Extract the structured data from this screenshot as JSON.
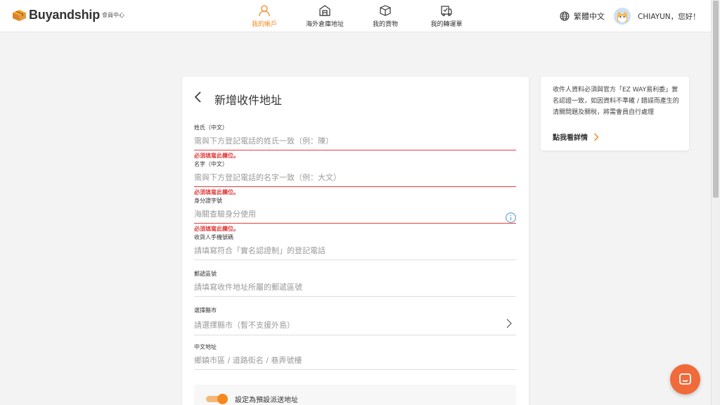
{
  "header": {
    "brand": "Buyandship",
    "member_center": "會員中心",
    "nav": [
      {
        "label": "我的帳戶",
        "icon": "user-icon",
        "active": true
      },
      {
        "label": "海外倉庫地址",
        "icon": "warehouse-icon",
        "active": false
      },
      {
        "label": "我的貨物",
        "icon": "box-icon",
        "active": false
      },
      {
        "label": "我的轉運單",
        "icon": "shipment-icon",
        "active": false
      }
    ],
    "language": "繁體中文",
    "greeting": "CHIAYUN，您好！"
  },
  "form": {
    "title": "新增收件地址",
    "fields": {
      "surname": {
        "label": "姓氏（中文）",
        "placeholder": "需與下方登記電話的姓氏一致（例：陳）",
        "error": "必須填寫此欄位。"
      },
      "given_name": {
        "label": "名字（中文）",
        "placeholder": "需與下方登記電話的名字一致（例：大文）",
        "error": "必須填寫此欄位。"
      },
      "id_number": {
        "label": "身分證字號",
        "placeholder": "海關查驗身分使用",
        "error": "必須填寫此欄位。"
      },
      "phone": {
        "label": "收貨人手機號碼",
        "placeholder": "請填寫符合「實名認證制」的登記電話"
      },
      "postal": {
        "label": "郵遞區號",
        "placeholder": "請填寫收件地址所屬的郵遞區號"
      },
      "city": {
        "label": "選擇縣市",
        "placeholder": "請選擇縣市（暫不支援外島）"
      },
      "address": {
        "label": "中文地址",
        "placeholder": "鄉鎮市區 / 道路街名 / 巷弄號樓"
      }
    },
    "default_toggle": {
      "label": "設定為預設派送地址",
      "on": true
    }
  },
  "side": {
    "notice": "收件人資料必須與官方「EZ WAY易利委」實名認證一致，如因資料不準確 / 錯誤而產生的清關問題及關稅，將需會員自行處理",
    "link": "點我看詳情"
  },
  "colors": {
    "accent": "#f5891f",
    "error": "#e14040",
    "chat": "#f06a3a"
  }
}
